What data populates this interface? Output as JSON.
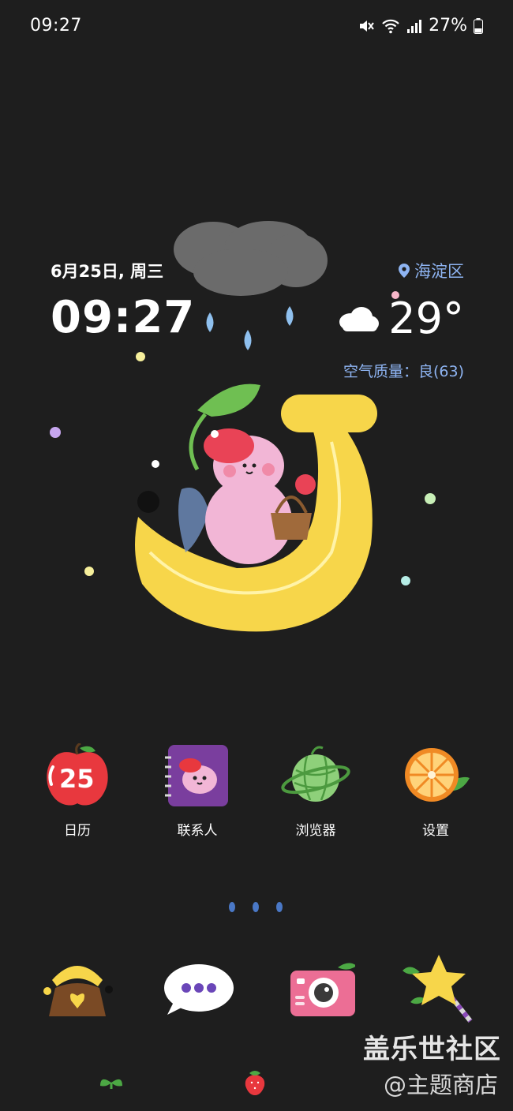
{
  "status_bar": {
    "time": "09:27",
    "battery": "27%"
  },
  "widget": {
    "date": "6月25日, 周三",
    "time": "09:27",
    "location": "海淀区",
    "temperature": "29°",
    "air_quality": "空气质量：良(63)"
  },
  "apps": [
    {
      "label": "日历",
      "icon": "calendar-icon",
      "badge": "25"
    },
    {
      "label": "联系人",
      "icon": "contacts-icon"
    },
    {
      "label": "浏览器",
      "icon": "browser-icon"
    },
    {
      "label": "设置",
      "icon": "settings-icon"
    }
  ],
  "dock": [
    {
      "icon": "phone-icon"
    },
    {
      "icon": "messages-icon"
    },
    {
      "icon": "camera-icon"
    },
    {
      "icon": "star-wand-icon"
    }
  ],
  "watermark": {
    "line1": "盖乐世社区",
    "line2": "@主题商店"
  },
  "colors": {
    "background": "#1e1e1e",
    "accent_blue": "#8eb4f2",
    "banana": "#f7d64a",
    "pink": "#f2b6d6"
  }
}
